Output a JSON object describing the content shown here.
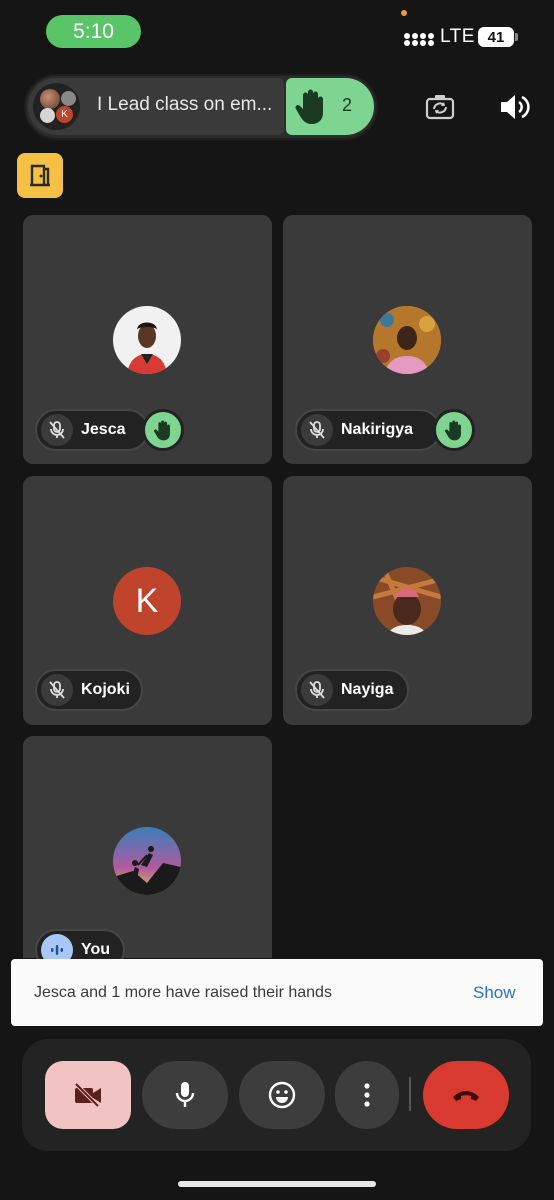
{
  "status_bar": {
    "time": "5:10",
    "network": "LTE",
    "battery": "41"
  },
  "meeting": {
    "title": "I Lead class on em...",
    "raised_hands_count": "2"
  },
  "participants": [
    {
      "name": "Jesca",
      "muted": true,
      "hand_raised": true,
      "avatar": "photo"
    },
    {
      "name": "Nakirigya",
      "muted": true,
      "hand_raised": true,
      "avatar": "photo"
    },
    {
      "name": "Kojoki",
      "muted": true,
      "hand_raised": false,
      "avatar_letter": "K"
    },
    {
      "name": "Nayiga",
      "muted": true,
      "hand_raised": false,
      "avatar": "photo"
    },
    {
      "name": "You",
      "muted": false,
      "hand_raised": false,
      "avatar": "photo"
    }
  ],
  "avatar_stack_letter": "K",
  "toast": {
    "message": "Jesca and 1 more have raised their hands",
    "action": "Show"
  },
  "controls": {
    "camera": "camera-off-icon",
    "mic": "mic-icon",
    "reactions": "emoji-icon",
    "more": "more-vert-icon",
    "end_call": "end-call-icon"
  },
  "colors": {
    "accent_green": "#7ed491",
    "end_call_red": "#d93a2f",
    "toast_link_blue": "#2a6fc9",
    "exit_badge_yellow": "#f5c043"
  }
}
